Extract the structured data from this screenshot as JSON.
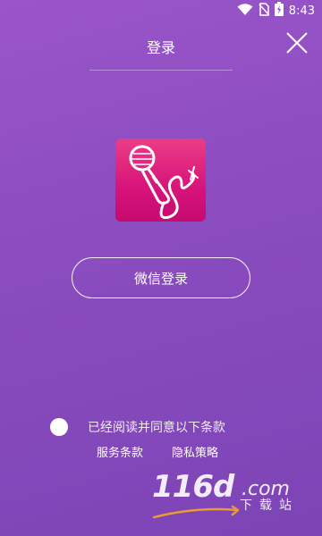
{
  "status_bar": {
    "time": "8:43",
    "icons": [
      "wifi-icon",
      "no-sim-icon",
      "battery-charging-icon"
    ]
  },
  "header": {
    "title": "登录",
    "close_icon": "close-icon"
  },
  "app_logo": {
    "icon": "microphone-icon",
    "colors": {
      "top": "#ea3d86",
      "bottom": "#c60a70"
    }
  },
  "login": {
    "wechat_label": "微信登录"
  },
  "agreement": {
    "text": "已经阅读并同意以下条款",
    "links": [
      "服务条款",
      "隐私策略"
    ]
  },
  "watermark": {
    "brand": "116d",
    "domain": ".com",
    "subtitle": "下载站"
  },
  "colors": {
    "background_top": "#9a55c9",
    "background_bottom": "#7d44b6",
    "text": "#ffffff"
  }
}
